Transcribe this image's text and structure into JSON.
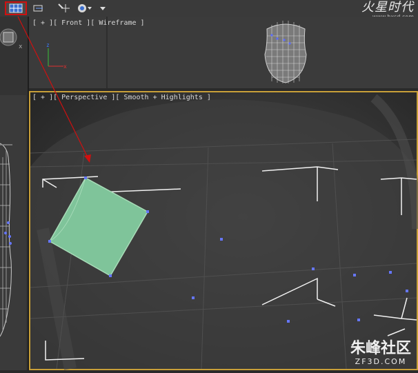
{
  "toolbar": {
    "buttons": [
      {
        "name": "viewport-layout-icon"
      },
      {
        "name": "select-icon"
      },
      {
        "name": "move-icon"
      },
      {
        "name": "render-icon"
      },
      {
        "name": "dropdown-arrow-icon"
      }
    ],
    "highlight_color": "#d01010"
  },
  "brand": {
    "logo_text": "火星时代",
    "url": "www.hxsd.com"
  },
  "viewports": {
    "front": {
      "label": "[ + ][ Front ][ Wireframe ]"
    },
    "perspective": {
      "label": "[ + ][ Perspective ][ Smooth + Highlights ]",
      "active_border_color": "#c9a038"
    }
  },
  "watermark": {
    "title": "朱峰社区",
    "subtitle": "ZF3D.COM"
  },
  "annotation": {
    "arrow_color": "#d01010"
  },
  "plane": {
    "fill_color": "#7fc49a"
  }
}
